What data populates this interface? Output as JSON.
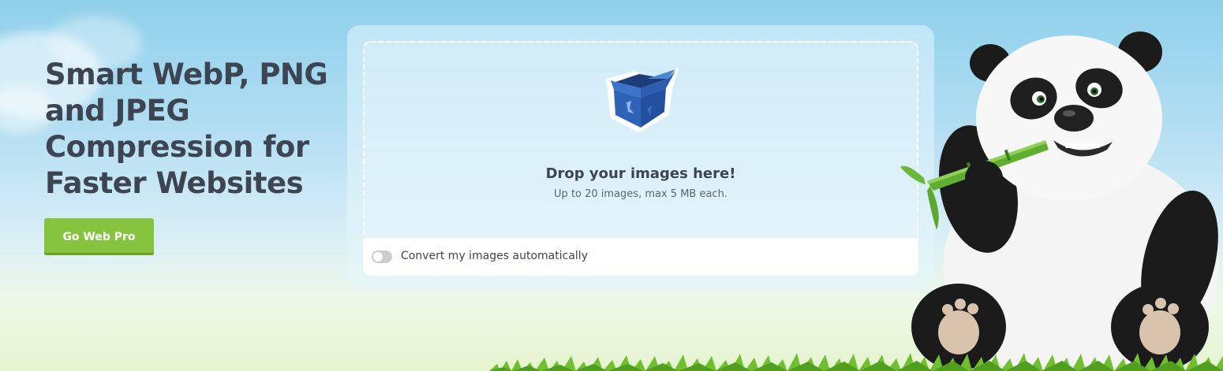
{
  "hero": {
    "title": "Smart WebP, PNG and JPEG Compression for Faster Websites",
    "cta_label": "Go Web Pro"
  },
  "uploader": {
    "drop_title": "Drop your images here!",
    "drop_subtitle": "Up to 20 images, max 5 MB each.",
    "box_icon": "box-icon",
    "convert_toggle": {
      "label": "Convert my images automatically",
      "checked": false
    }
  },
  "illustration": {
    "mascot": "panda-mascot",
    "ground": "grass"
  },
  "colors": {
    "accent_green": "#86c440",
    "text_dark": "#3d4452",
    "sky": "#8fd0ec",
    "toggle_off": "#c9ccd1"
  }
}
